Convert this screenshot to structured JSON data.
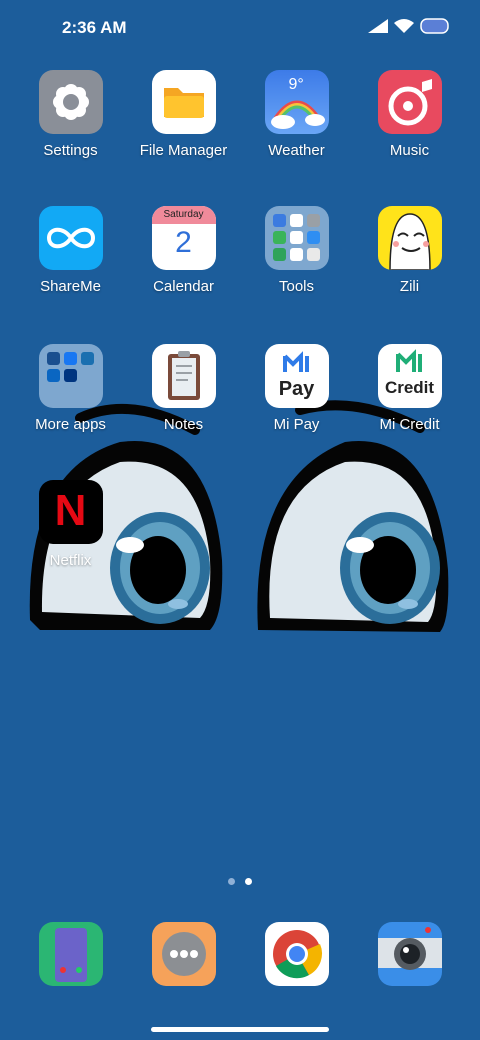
{
  "status": {
    "time": "2:36 AM"
  },
  "apps": [
    {
      "label": "Settings",
      "icon": "settings-icon"
    },
    {
      "label": "File Manager",
      "icon": "folder-icon"
    },
    {
      "label": "Weather",
      "icon": "weather-icon",
      "temp": "9°"
    },
    {
      "label": "Music",
      "icon": "music-icon"
    },
    {
      "label": "ShareMe",
      "icon": "shareme-icon"
    },
    {
      "label": "Calendar",
      "icon": "calendar-icon",
      "day": "Saturday",
      "date": "2"
    },
    {
      "label": "Tools",
      "icon": "tools-folder-icon"
    },
    {
      "label": "Zili",
      "icon": "zili-icon"
    },
    {
      "label": "More apps",
      "icon": "more-apps-folder-icon"
    },
    {
      "label": "Notes",
      "icon": "notes-icon"
    },
    {
      "label": "Mi Pay",
      "icon": "mi-pay-icon",
      "text": "Pay"
    },
    {
      "label": "Mi Credit",
      "icon": "mi-credit-icon",
      "text": "Credit"
    },
    {
      "label": "Netflix",
      "icon": "netflix-icon",
      "letter": "N"
    }
  ],
  "dock": [
    {
      "icon": "phone-icon"
    },
    {
      "icon": "messages-icon"
    },
    {
      "icon": "chrome-icon"
    },
    {
      "icon": "camera-icon"
    }
  ],
  "pages": {
    "count": 2,
    "current": 2
  },
  "colors": {
    "wallpaper": "#1c5d9b"
  }
}
